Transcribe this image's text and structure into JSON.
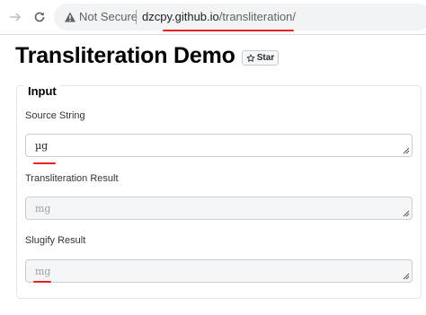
{
  "browser": {
    "security_label": "Not Secure",
    "url_host": "dzcpy.github.io",
    "url_path": "/transliteration/"
  },
  "page": {
    "title": "Transliteration Demo",
    "star_label": "Star"
  },
  "input_section": {
    "legend": "Input",
    "source_label": "Source String",
    "source_value": "µg",
    "result_label": "Transliteration Result",
    "result_value": "mg",
    "slugify_label": "Slugify Result",
    "slugify_value": "mg"
  },
  "colors": {
    "highlight": "#e8221b"
  }
}
